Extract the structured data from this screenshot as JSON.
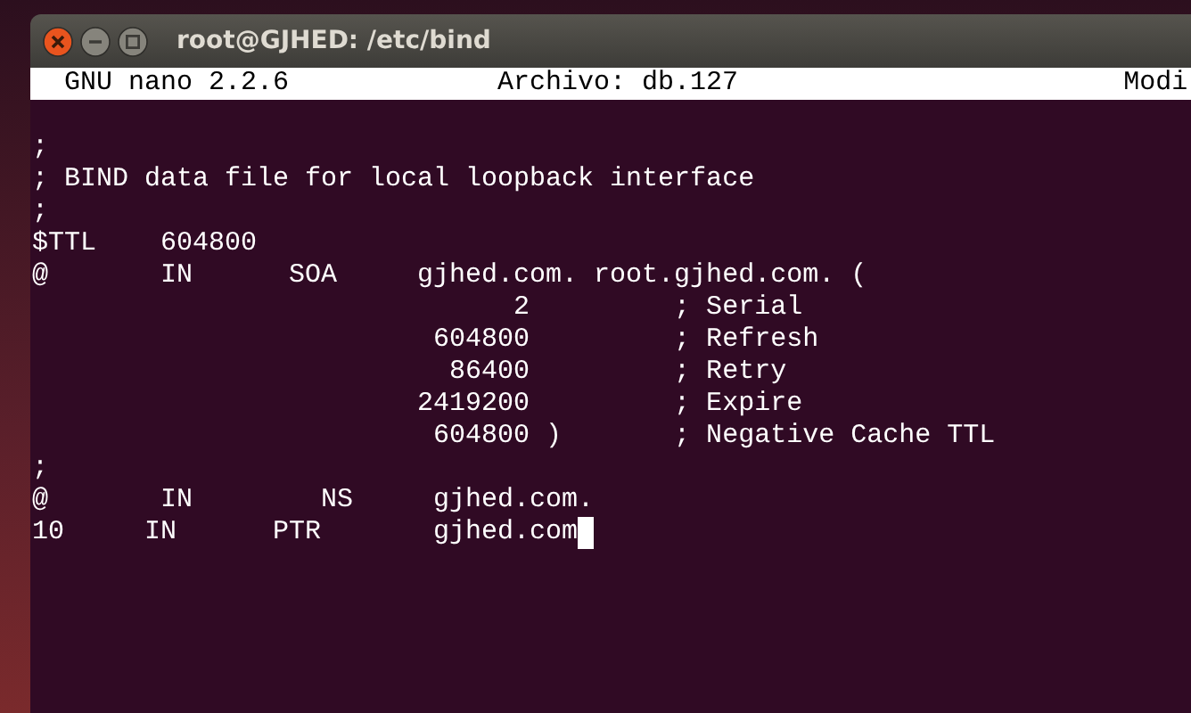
{
  "window": {
    "title": "root@GJHED: /etc/bind"
  },
  "header": {
    "app": "GNU nano 2.2.6",
    "file": "Archivo: db.127",
    "status": "Modi"
  },
  "lines": [
    ";",
    "; BIND data file for local loopback interface",
    ";",
    "$TTL    604800",
    "@       IN      SOA     gjhed.com. root.gjhed.com. (",
    "                              2         ; Serial",
    "                         604800         ; Refresh",
    "                          86400         ; Retry",
    "                        2419200         ; Expire",
    "                         604800 )       ; Negative Cache TTL",
    ";",
    "@       IN        NS     gjhed.com.",
    "10     IN      PTR       gjhed.com"
  ],
  "cursor_on_last_line": true
}
